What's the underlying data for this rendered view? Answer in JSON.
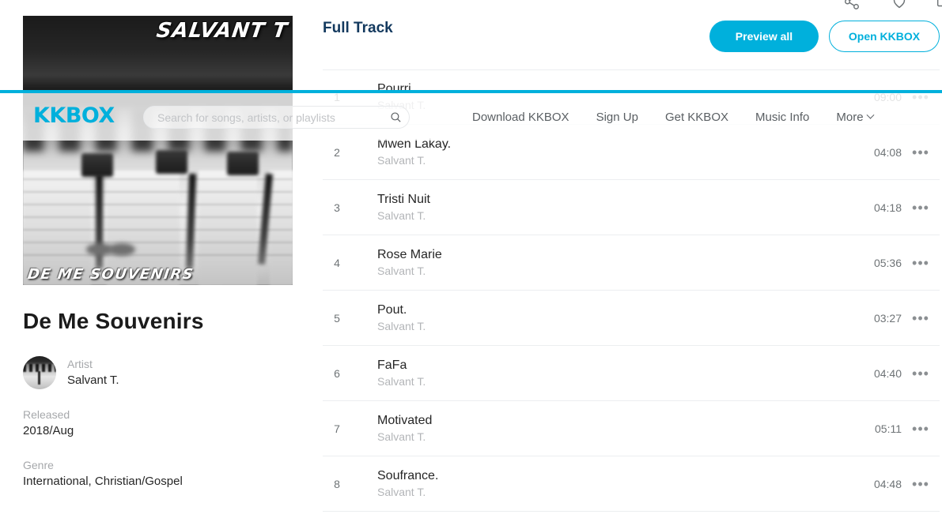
{
  "top_icons": [
    {
      "name": "share-icon"
    },
    {
      "name": "heart-icon"
    },
    {
      "name": "save-icon"
    }
  ],
  "header": {
    "logo": "KKBOX",
    "search": {
      "placeholder": "Search for songs, artists, or playlists",
      "value": ""
    },
    "nav": [
      {
        "label": "Download KKBOX",
        "has_chevron": false
      },
      {
        "label": "Sign Up",
        "has_chevron": false
      },
      {
        "label": "Get KKBOX",
        "has_chevron": false
      },
      {
        "label": "Music Info",
        "has_chevron": false
      },
      {
        "label": "More",
        "has_chevron": true
      }
    ]
  },
  "album": {
    "title": "De Me Souvenirs",
    "cover_text_top": "SALVANT T",
    "cover_text_bottom": "DE ME SOUVENIRS",
    "artist_label": "Artist",
    "artist_name": "Salvant T.",
    "released_label": "Released",
    "released_value": "2018/Aug",
    "genre_label": "Genre",
    "genre_value": "International,  Christian/Gospel"
  },
  "main": {
    "section_title": "Full Track",
    "preview_all_label": "Preview all",
    "open_kkbox_label": "Open KKBOX",
    "more_glyph": "•••"
  },
  "tracks": [
    {
      "num": "1",
      "name": "Pourri.",
      "artist": "Salvant T.",
      "duration": "09:00"
    },
    {
      "num": "2",
      "name": "Mwen Lakay.",
      "artist": "Salvant T.",
      "duration": "04:08"
    },
    {
      "num": "3",
      "name": "Tristi Nuit",
      "artist": "Salvant T.",
      "duration": "04:18"
    },
    {
      "num": "4",
      "name": "Rose Marie",
      "artist": "Salvant T.",
      "duration": "05:36"
    },
    {
      "num": "5",
      "name": "Pout.",
      "artist": "Salvant T.",
      "duration": "03:27"
    },
    {
      "num": "6",
      "name": "FaFa",
      "artist": "Salvant T.",
      "duration": "04:40"
    },
    {
      "num": "7",
      "name": "Motivated",
      "artist": "Salvant T.",
      "duration": "05:11"
    },
    {
      "num": "8",
      "name": "Soufrance.",
      "artist": "Salvant T.",
      "duration": "04:48"
    }
  ],
  "colors": {
    "accent": "#00b0dc",
    "heading": "#13395e",
    "text": "#262626",
    "muted": "#b3b5b8"
  }
}
